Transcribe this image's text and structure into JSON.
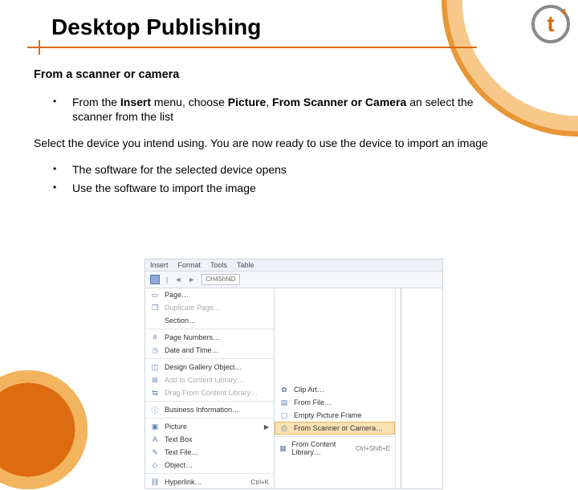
{
  "title": "Desktop Publishing",
  "logo": {
    "letter": "t",
    "sup": "4"
  },
  "section1_heading": "From a scanner or camera",
  "bullet1_pre": "From the ",
  "bullet1_b1": "Insert",
  "bullet1_mid1": " menu, choose ",
  "bullet1_b2": "Picture",
  "bullet1_mid2": ", ",
  "bullet1_b3": "From Scanner or Camera",
  "bullet1_post": " an select the scanner from the list",
  "para": "Select the device you intend using. You are now ready to use the device to import an image",
  "bullet2": "The software for the selected device opens",
  "bullet3": "Use the software to import the image",
  "menubar": {
    "insert": "Insert",
    "format": "Format",
    "tools": "Tools",
    "table": "Table"
  },
  "toolbar_box": "CH45hf4D",
  "menu": {
    "page": "Page…",
    "dup": "Duplicate Page…",
    "section": "Section…",
    "pagenum": "Page Numbers…",
    "datetime": "Date and Time…",
    "dgo": "Design Gallery Object…",
    "addcl": "Add to Content Library…",
    "dragcl": "Drag From Content Library…",
    "bizinfo": "Business Information…",
    "picture": "Picture",
    "textbox": "Text Box",
    "textfile": "Text File…",
    "object": "Object…",
    "hyperlink": "Hyperlink…",
    "hl_shortcut": "Ctrl+K"
  },
  "submenu": {
    "clipart": "Clip Art…",
    "fromfile": "From File…",
    "emptyframe": "Empty Picture Frame",
    "fromscanner": "From Scanner or Camera…",
    "fromitems": "From Content Library…",
    "shortcut": "Ctrl+Shift+E"
  }
}
